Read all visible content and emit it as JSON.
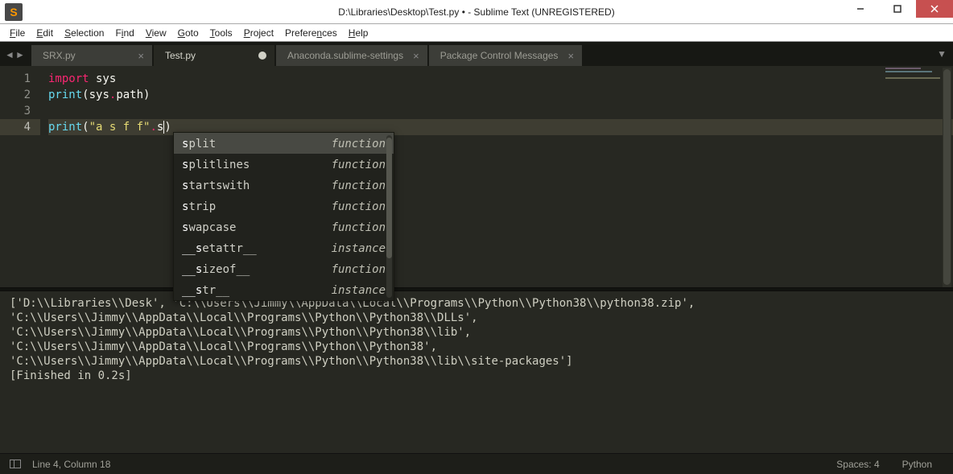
{
  "title": "D:\\Libraries\\Desktop\\Test.py • - Sublime Text (UNREGISTERED)",
  "menu": [
    "File",
    "Edit",
    "Selection",
    "Find",
    "View",
    "Goto",
    "Tools",
    "Project",
    "Preferences",
    "Help"
  ],
  "tabs": [
    {
      "label": "SRX.py",
      "active": false,
      "dirty": false
    },
    {
      "label": "Test.py",
      "active": true,
      "dirty": true
    },
    {
      "label": "Anaconda.sublime-settings",
      "active": false,
      "dirty": false
    },
    {
      "label": "Package Control Messages",
      "active": false,
      "dirty": false
    }
  ],
  "gutter": [
    "1",
    "2",
    "3",
    "4"
  ],
  "code": {
    "l1_import": "import",
    "l1_sys": " sys",
    "l2_print": "print",
    "l2_open": "(",
    "l2_sys": "sys",
    "l2_dot": ".",
    "l2_path": "path",
    "l2_close": ")",
    "l4_print": "print",
    "l4_open": "(",
    "l4_str": "\"a s f f\"",
    "l4_dot": ".",
    "l4_s": "s",
    "l4_close": ")"
  },
  "autocomplete": [
    {
      "name": "split",
      "match": "s",
      "rest": "plit",
      "kind": "function",
      "selected": true
    },
    {
      "name": "splitlines",
      "match": "s",
      "rest": "plitlines",
      "kind": "function",
      "selected": false
    },
    {
      "name": "startswith",
      "match": "s",
      "rest": "tartswith",
      "kind": "function",
      "selected": false
    },
    {
      "name": "strip",
      "match": "s",
      "rest": "trip",
      "kind": "function",
      "selected": false
    },
    {
      "name": "swapcase",
      "match": "s",
      "rest": "wapcase",
      "kind": "function",
      "selected": false
    },
    {
      "name": "__setattr__",
      "match": "__s",
      "rest": "etattr__",
      "kind": "instance",
      "selected": false
    },
    {
      "name": "__sizeof__",
      "match": "__s",
      "rest": "izeof__",
      "kind": "function",
      "selected": false
    },
    {
      "name": "__str__",
      "match": "__s",
      "rest": "tr__",
      "kind": "instance",
      "selected": false
    }
  ],
  "output": "['D:\\\\Libraries\\\\Desk', 'C:\\\\Users\\\\Jimmy\\\\AppData\\\\Local\\\\Programs\\\\Python\\\\Python38\\\\python38.zip',\n'C:\\\\Users\\\\Jimmy\\\\AppData\\\\Local\\\\Programs\\\\Python\\\\Python38\\\\DLLs',\n'C:\\\\Users\\\\Jimmy\\\\AppData\\\\Local\\\\Programs\\\\Python\\\\Python38\\\\lib',\n'C:\\\\Users\\\\Jimmy\\\\AppData\\\\Local\\\\Programs\\\\Python\\\\Python38',\n'C:\\\\Users\\\\Jimmy\\\\AppData\\\\Local\\\\Programs\\\\Python\\\\Python38\\\\lib\\\\site-packages']\n[Finished in 0.2s]",
  "status": {
    "position": "Line 4, Column 18",
    "spaces": "Spaces: 4",
    "lang": "Python"
  }
}
